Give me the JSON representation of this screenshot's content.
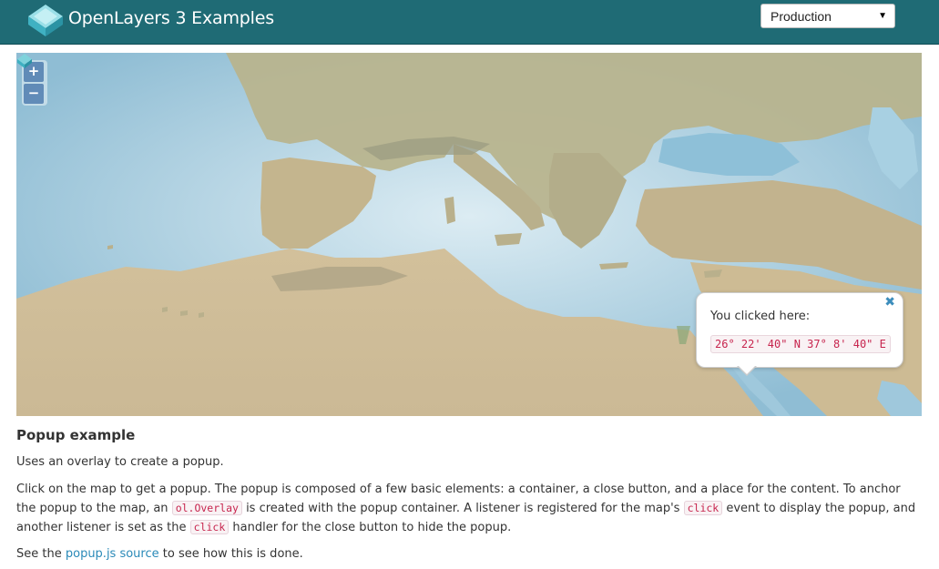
{
  "header": {
    "title": "OpenLayers 3 Examples",
    "version_selected": "Production"
  },
  "map": {
    "zoom_in_label": "+",
    "zoom_out_label": "−",
    "popup": {
      "label": "You clicked here:",
      "coordinate": "26° 22' 40\" N 37° 8' 40\" E",
      "close_label": "✖"
    }
  },
  "content": {
    "title": "Popup example",
    "short_desc": "Uses an overlay to create a popup.",
    "desc_part1": "Click on the map to get a popup. The popup is composed of a few basic elements: a container, a close button, and a place for the content. To anchor the popup to the map, an ",
    "code_overlay": "ol.Overlay",
    "desc_part2": " is created with the popup container. A listener is registered for the map's ",
    "code_click1": "click",
    "desc_part3": " event to display the popup, and another listener is set as the ",
    "code_click2": "click",
    "desc_part4": " handler for the close button to hide the popup.",
    "see_prefix": "See the ",
    "source_link": "popup.js source",
    "see_suffix": " to see how this is done."
  },
  "colors": {
    "navbar": "#1f6b75",
    "link": "#2a8ab8",
    "code_text": "#c7254e",
    "sea": "#b3d4e3",
    "land": "#c9b892"
  }
}
